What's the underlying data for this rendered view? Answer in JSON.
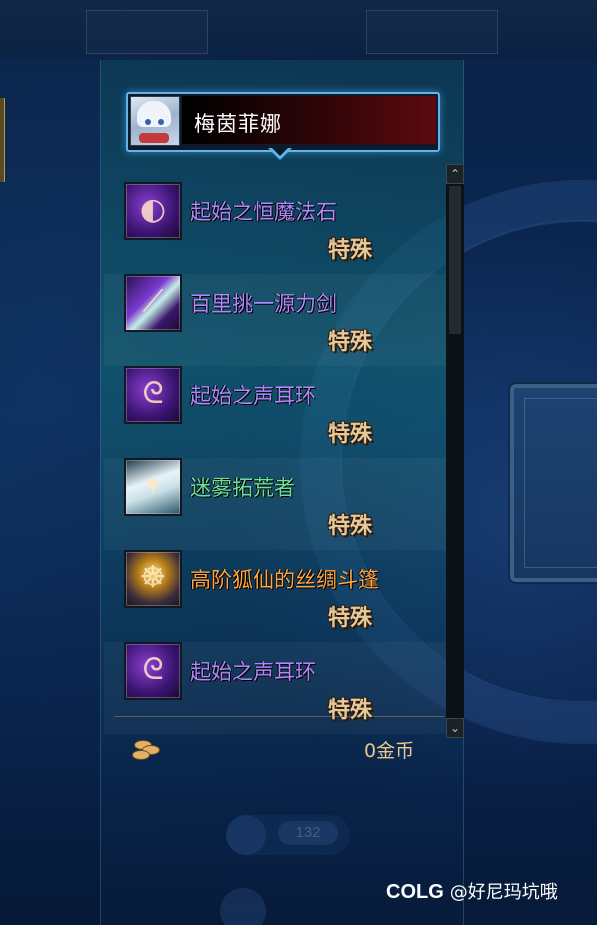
{
  "character": {
    "name": "梅茵菲娜"
  },
  "items": [
    {
      "name": "起始之恒魔法石",
      "tag": "特殊",
      "color": "#b487ff",
      "icon": "cursed-stone-icon"
    },
    {
      "name": "百里挑一源力剑",
      "tag": "特殊",
      "color": "#b487ff",
      "icon": "sword-icon"
    },
    {
      "name": "起始之声耳环",
      "tag": "特殊",
      "color": "#b487ff",
      "icon": "earring-icon"
    },
    {
      "name": "迷雾拓荒者",
      "tag": "特殊",
      "color": "#6fe09a",
      "icon": "white-armor-icon"
    },
    {
      "name": "高阶狐仙的丝绸斗篷",
      "tag": "特殊",
      "color": "#ffa640",
      "icon": "silk-cloak-icon"
    },
    {
      "name": "起始之声耳环",
      "tag": "特殊",
      "color": "#b487ff",
      "icon": "earring-icon"
    }
  ],
  "footer": {
    "gold": "0金币",
    "coin_icon": "coin-stack-icon"
  },
  "background": {
    "badge_number": "132"
  },
  "watermark": {
    "logo": "COLG",
    "text": "@好尼玛坑哦"
  },
  "scrollbar": {
    "up_glyph": "⌃",
    "down_glyph": "⌄"
  }
}
